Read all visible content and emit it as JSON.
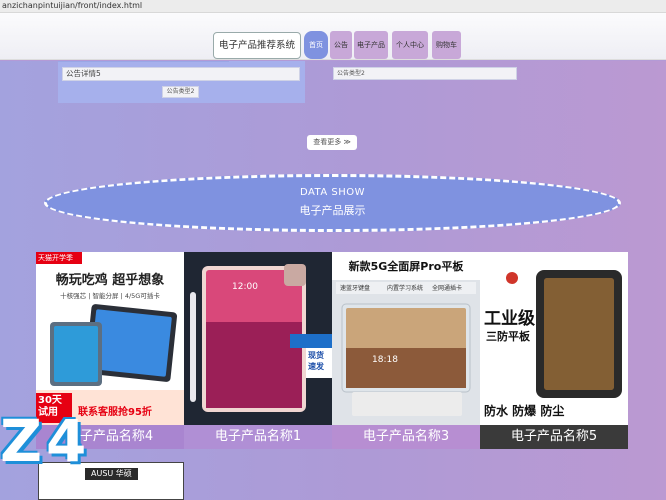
{
  "browser": {
    "url": "anzichanpintuijian/front/index.html"
  },
  "header": {
    "site_title": "电子产品推荐系统",
    "nav": [
      {
        "label": "首页",
        "active": true
      },
      {
        "label": "公告",
        "active": false
      },
      {
        "label": "电子产品",
        "active": false
      },
      {
        "label": "个人中心",
        "active": false
      },
      {
        "label": "购物车",
        "active": false
      }
    ]
  },
  "notices": {
    "detail_title": "公告详情5",
    "type_left": "公告类型2",
    "type_right": "公告类型2"
  },
  "more_label": "查看更多 ≫",
  "data_show": {
    "en": "DATA SHOW",
    "cn": "电子产品展示"
  },
  "products": [
    {
      "name": "电子产品名称4",
      "promo_top": "天猫开学季",
      "headline": "畅玩吃鸡 超乎想象",
      "features": "十核强芯 | 智能分屏 | 4/5G可插卡",
      "badge": "30天试用",
      "deal": "联系客服抢95折"
    },
    {
      "name": "电子产品名称1",
      "screen_time": "12:00",
      "tag": "现货速发"
    },
    {
      "name": "电子产品名称3",
      "headline": "新款5G全面屏Pro平板",
      "features": [
        "速蓝牙键盘",
        "内置学习系统",
        "全网通插卡"
      ],
      "screen_time": "18:18"
    },
    {
      "name": "电子产品名称5",
      "headline": "工业级",
      "subhead": "三防平板",
      "features": "防水 防爆 防尘"
    }
  ],
  "bottom_card": {
    "brand": "AUSU 华硕"
  },
  "overlay_text": "Z4"
}
